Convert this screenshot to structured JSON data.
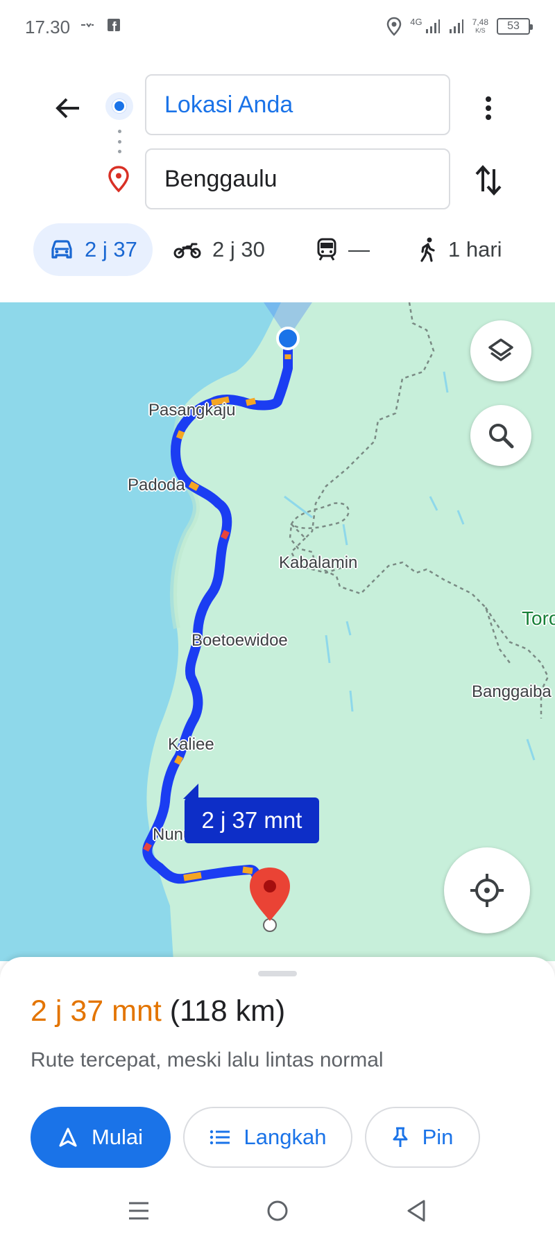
{
  "status_bar": {
    "time": "17.30",
    "network": "4G",
    "speed_value": "7,48",
    "speed_unit": "K/S",
    "battery": "53",
    "icons": [
      "notification-icon",
      "facebook-icon",
      "location-icon",
      "signal-icon",
      "wifi-signal-icon"
    ]
  },
  "header": {
    "origin_value": "Lokasi Anda",
    "destination_value": "Benggaulu",
    "icons": [
      "back-arrow-icon",
      "more-vert-icon",
      "swap-icon"
    ]
  },
  "travel_modes": [
    {
      "name": "car",
      "label": "2 j 37",
      "active": true
    },
    {
      "name": "motorcycle",
      "label": "2 j 30",
      "active": false
    },
    {
      "name": "transit",
      "label": "—",
      "active": false
    },
    {
      "name": "walk",
      "label": "1 hari",
      "active": false
    }
  ],
  "map": {
    "places": [
      "Pasangkaju",
      "Padoda",
      "Kabalamin",
      "Boetoewidoe",
      "Kaliee",
      "Nunu",
      "Toro",
      "Banggaiba"
    ],
    "route_duration_chip": "2 j 37 mnt",
    "colors": {
      "sea": "#8ed8ea",
      "land": "#c7efda",
      "route": "#1b3df2",
      "traffic": "#f5a623",
      "pin": "#ea4335"
    }
  },
  "sheet": {
    "time": "2 j 37 mnt",
    "distance": "(118 km)",
    "note": "Rute tercepat, meski lalu lintas normal",
    "buttons": {
      "start": "Mulai",
      "steps": "Langkah",
      "pin": "Pin"
    }
  }
}
